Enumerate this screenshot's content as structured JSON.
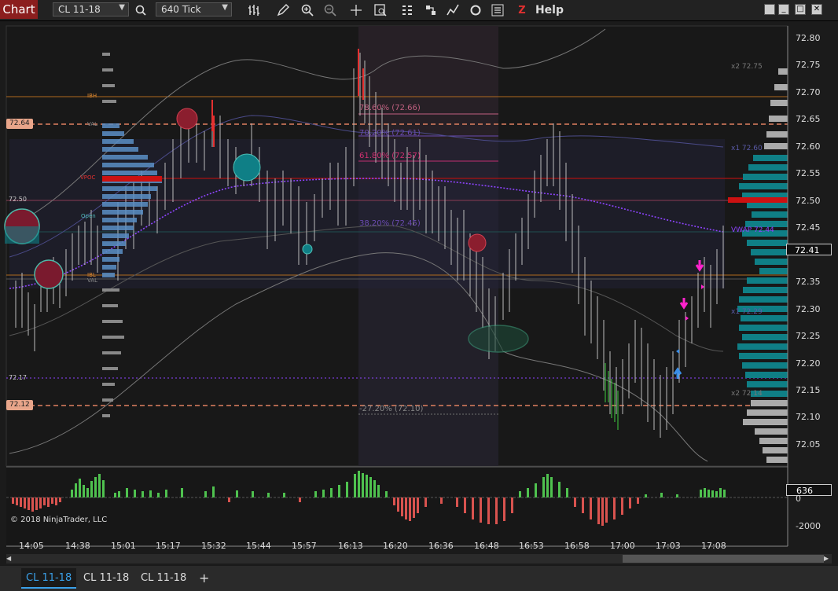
{
  "toolbar": {
    "chart_tab": "Chart",
    "instrument": "CL 11-18",
    "interval": "640 Tick",
    "help": "Help",
    "z_label": "Z"
  },
  "price_axis": {
    "ticks": [
      "72.80",
      "72.75",
      "72.70",
      "72.65",
      "72.60",
      "72.55",
      "72.50",
      "72.45",
      "72.40",
      "72.35",
      "72.30",
      "72.25",
      "72.20",
      "72.15",
      "72.10",
      "72.05"
    ],
    "current_price": "72.41",
    "left_labels": [
      "72.64",
      "72.50",
      "72.17",
      "72.12"
    ]
  },
  "indicator_axis": {
    "current": "636",
    "ticks": [
      "0",
      "-2000"
    ]
  },
  "time_axis": [
    "14:05",
    "14:38",
    "15:01",
    "15:17",
    "15:32",
    "15:44",
    "15:57",
    "16:13",
    "16:20",
    "16:36",
    "16:48",
    "16:53",
    "16:58",
    "17:00",
    "17:03",
    "17:08"
  ],
  "annotations": {
    "ibh": "IBH",
    "val_top": "VAL",
    "vpoc": "VPOC",
    "open": "Open",
    "ibl": "IBL",
    "val_bottom": "VAL",
    "x2_top": "x2 72.75",
    "x1_top": "x1 72.60",
    "vwap": "VWAP 72.44",
    "x1_bottom": "x1 72.29",
    "x2_bottom": "x2 72.14"
  },
  "fibs": [
    "78.60% (72.66)",
    "70.20% (72.61)",
    "61.80% (72.57)",
    "38.20% (72.45)",
    "-27.20% (72.10)"
  ],
  "copyright": "© 2018 NinjaTrader, LLC",
  "bottom_tabs": [
    "CL 11-18",
    "CL 11-18",
    "CL 11-18"
  ],
  "add_tab": "+",
  "colors": {
    "accent": "#8b1e1e",
    "up": "#4fc24f",
    "down": "#d9534f",
    "profile": "#0f7f86",
    "vwap": "#8e44ff"
  }
}
